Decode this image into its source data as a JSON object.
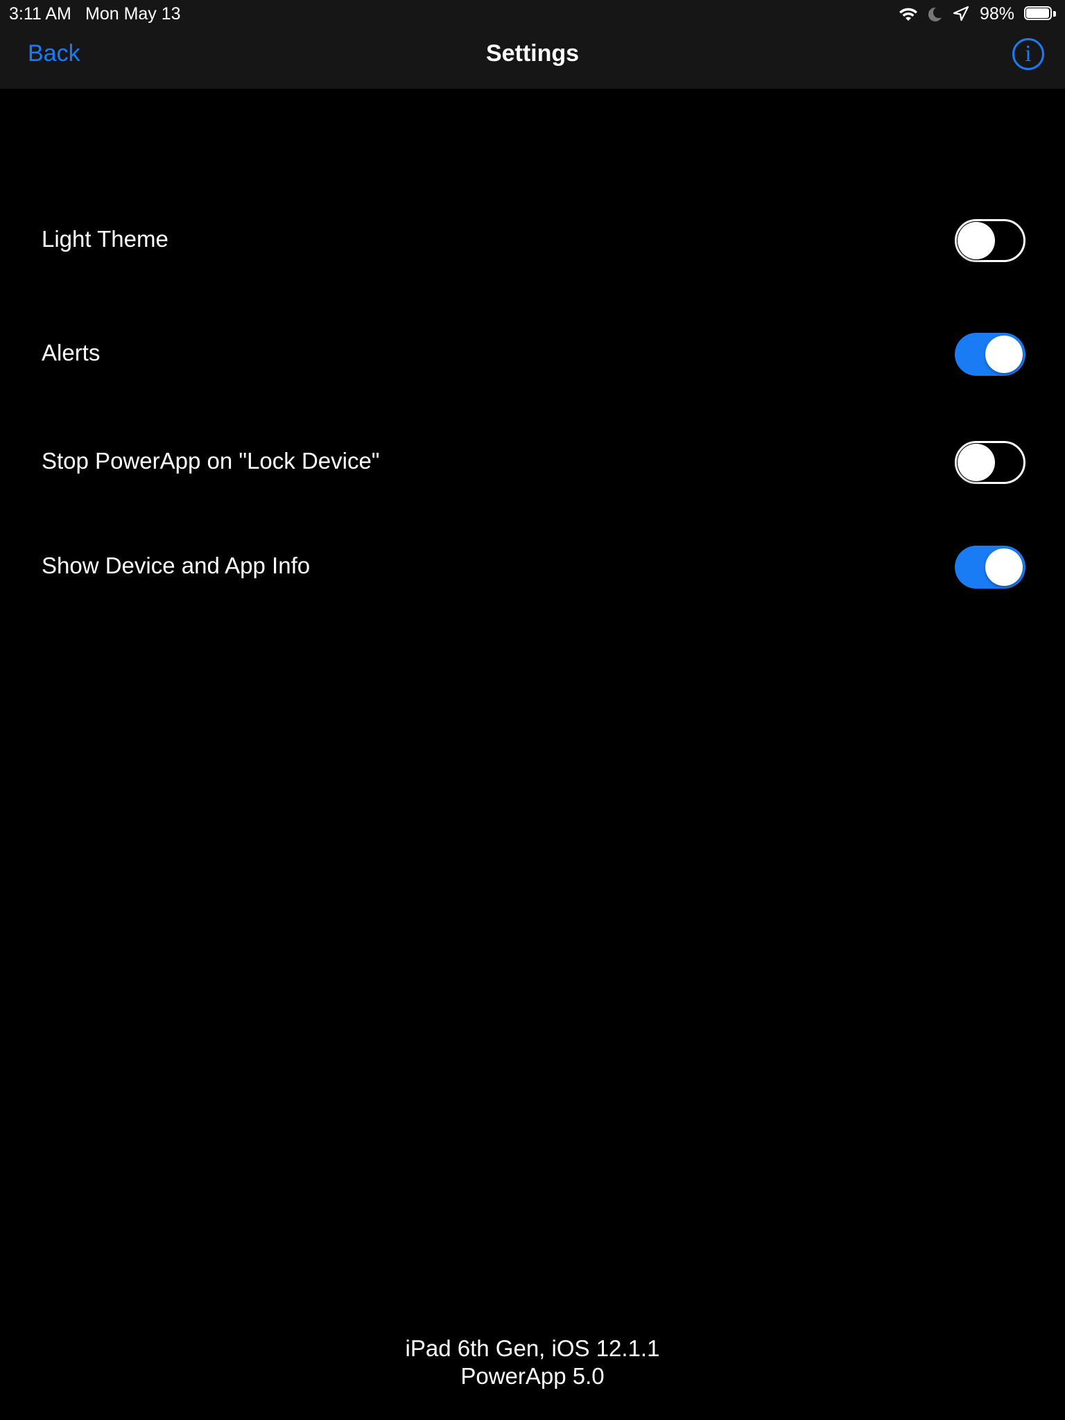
{
  "status_bar": {
    "time": "3:11 AM",
    "date": "Mon May 13",
    "battery_percent_label": "98%",
    "battery_level": 0.98,
    "icons": [
      "wifi-icon",
      "do-not-disturb-moon-icon",
      "location-arrow-icon",
      "battery-icon"
    ]
  },
  "nav": {
    "back_label": "Back",
    "title": "Settings",
    "info_glyph": "i",
    "info_icon": "info-circle-icon"
  },
  "settings": {
    "items": [
      {
        "label": "Light Theme",
        "enabled": false
      },
      {
        "label": "Alerts",
        "enabled": true
      },
      {
        "label": "Stop PowerApp on \"Lock Device\"",
        "enabled": false
      },
      {
        "label": "Show Device and App Info",
        "enabled": true
      }
    ]
  },
  "footer": {
    "device_info": "iPad 6th Gen, iOS 12.1.1",
    "app_version": "PowerApp 5.0"
  },
  "colors": {
    "accent": "#1a7cf5",
    "background": "#000000",
    "bar_background": "#161616",
    "text": "#ffffff"
  }
}
